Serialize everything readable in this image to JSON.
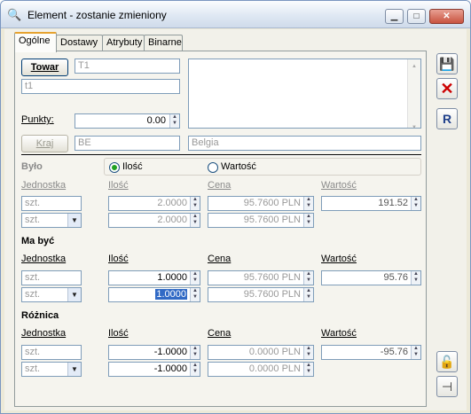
{
  "window": {
    "title": "Element - zostanie zmieniony",
    "min_glyph": "▁",
    "max_glyph": "□",
    "close_glyph": "✕"
  },
  "tabs": [
    {
      "label": "Ogólne",
      "active": true
    },
    {
      "label": "Dostawy",
      "active": false
    },
    {
      "label": "Atrybuty",
      "active": false
    },
    {
      "label": "Binarne",
      "active": false
    }
  ],
  "top": {
    "towar_button": "Towar",
    "towar_code": "T1",
    "towar_name": "t1",
    "punkty_label": "Punkty:",
    "punkty_value": "0.00",
    "kraj_button": "Kraj",
    "kraj_code": "BE",
    "kraj_name": "Belgia"
  },
  "bylo": {
    "title": "Było",
    "radio_ilosc": "Ilość",
    "radio_wartosc": "Wartość",
    "col_jednostka": "Jednostka",
    "col_ilosc": "Ilość",
    "col_cena": "Cena",
    "col_wartosc": "Wartość",
    "row1": {
      "jednostka": "szt.",
      "ilosc": "2.0000",
      "cena": "95.7600 PLN",
      "wartosc": "191.52"
    },
    "row2": {
      "jednostka": "szt.",
      "ilosc": "2.0000",
      "cena": "95.7600 PLN"
    }
  },
  "ma_byc": {
    "title": "Ma być",
    "col_jednostka": "Jednostka",
    "col_ilosc": "Ilość",
    "col_cena": "Cena",
    "col_wartosc": "Wartość",
    "row1": {
      "jednostka": "szt.",
      "ilosc": "1.0000",
      "cena": "95.7600 PLN",
      "wartosc": "95.76"
    },
    "row2": {
      "jednostka": "szt.",
      "ilosc": "1.0000",
      "cena": "95.7600 PLN"
    }
  },
  "roznica": {
    "title": "Różnica",
    "col_jednostka": "Jednostka",
    "col_ilosc": "Ilość",
    "col_cena": "Cena",
    "col_wartosc": "Wartość",
    "row1": {
      "jednostka": "szt.",
      "ilosc": "-1.0000",
      "cena": "0.0000 PLN",
      "wartosc": "-95.76"
    },
    "row2": {
      "jednostka": "szt.",
      "ilosc": "-1.0000",
      "cena": "0.0000 PLN"
    }
  },
  "icons": {
    "save": "save-icon",
    "cancel": "cancel-icon",
    "report": "report-icon",
    "lock": "lock-icon",
    "pin": "pin-icon"
  },
  "colors": {
    "selection": "#316ac5",
    "cancel_red": "#cc0000",
    "active_tab_accent": "#e6a22f"
  }
}
